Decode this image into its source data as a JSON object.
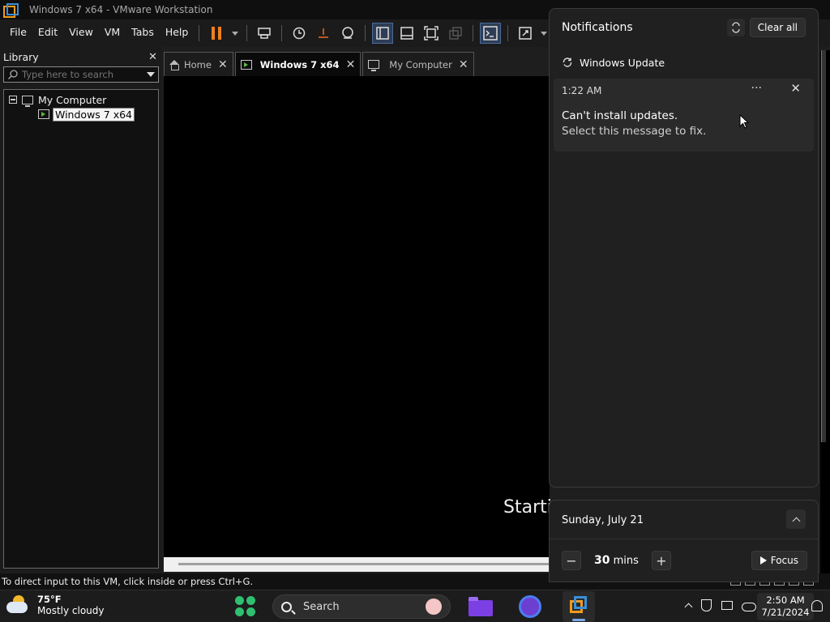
{
  "window": {
    "title": "Windows 7 x64 - VMware Workstation"
  },
  "menu": {
    "items": [
      "File",
      "Edit",
      "View",
      "VM",
      "Tabs",
      "Help"
    ]
  },
  "library": {
    "title": "Library",
    "search_placeholder": "Type here to search",
    "tree": {
      "root": "My Computer",
      "child": "Windows 7 x64"
    }
  },
  "tabs": [
    {
      "label": "Home",
      "icon": "home-icon"
    },
    {
      "label": "Windows 7 x64",
      "icon": "vm-icon",
      "active": true
    },
    {
      "label": "My Computer",
      "icon": "monitor-icon"
    }
  ],
  "console": {
    "boot_text": "Starti"
  },
  "statusbar": {
    "message": "To direct input to this VM, click inside or press Ctrl+G."
  },
  "notifications": {
    "title": "Notifications",
    "clear_all": "Clear all",
    "group": "Windows Update",
    "card": {
      "time": "1:22 AM",
      "headline": "Can't install updates.",
      "body": "Select this message to fix."
    }
  },
  "focus": {
    "date": "Sunday, July 21",
    "minutes": "30",
    "unit": "mins",
    "button": "Focus"
  },
  "taskbar": {
    "temperature": "75°F",
    "weather": "Mostly cloudy",
    "search_label": "Search",
    "time": "2:50 AM",
    "date": "7/21/2024"
  },
  "colors": {
    "accent_orange": "#f29b1d",
    "accent_blue": "#3a8fd8",
    "vm_green": "#5fb844",
    "pause_orange": "#f07f1d"
  }
}
